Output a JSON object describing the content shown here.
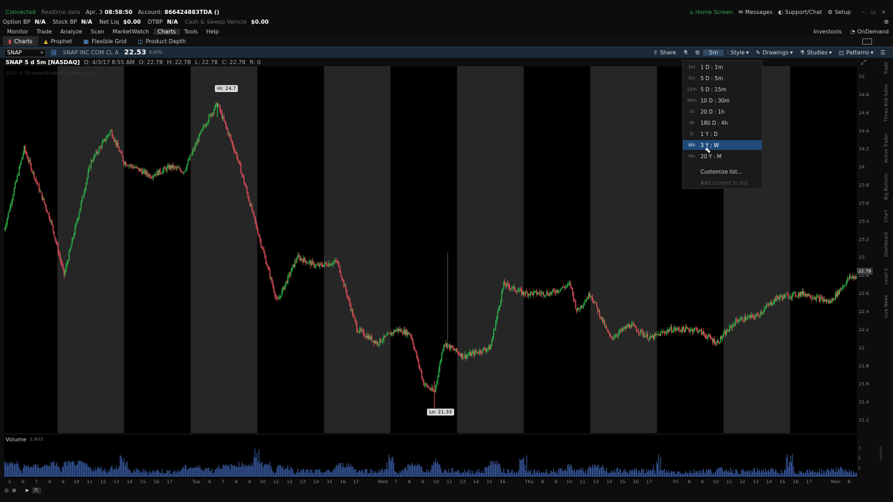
{
  "status_bar": {
    "connection": "Connected",
    "data_mode": "Realtime data",
    "date": "Apr, 3",
    "time": "08:58:50",
    "account_label": "Account:",
    "account_id": "866424883TDA ()",
    "home_screen": "Home Screen",
    "messages": "Messages",
    "support": "Support/Chat",
    "setup": "Setup"
  },
  "account_bar": {
    "option_bp_label": "Option BP",
    "option_bp_value": "N/A",
    "stock_bp_label": "Stock BP",
    "stock_bp_value": "N/A",
    "net_liq_label": "Net Liq",
    "net_liq_value": "$0.00",
    "dtbp_label": "DTBP",
    "dtbp_value": "N/A",
    "cash_sweep_label": "Cash & Sweep Vehicle",
    "cash_sweep_value": "$0.00"
  },
  "menu": {
    "items": [
      "Monitor",
      "Trade",
      "Analyze",
      "Scan",
      "MarketWatch",
      "Charts",
      "Tools",
      "Help"
    ],
    "active": "Charts",
    "investools": "Investools",
    "ondemand": "OnDemand"
  },
  "tabs": {
    "charts": "Charts",
    "prophet": "Prophet",
    "flexible_grid": "Flexible Grid",
    "product_depth": "Product Depth"
  },
  "chart_toolbar": {
    "symbol": "SNAP",
    "company": "SNAP INC COM CL A",
    "price": "22.53",
    "change": "0.00%",
    "share": "Share",
    "timeframe": "5m",
    "style": "Style",
    "drawings": "Drawings",
    "studies": "Studies",
    "patterns": "Patterns"
  },
  "chart_header": {
    "title": "SNAP 5 d 5m [NASDAQ]",
    "info": "D: 4/3/17 8:55 AM",
    "open": "O: 22.78",
    "high": "H: 22.78",
    "low": "L: 22.78",
    "close": "C: 22.78",
    "r": "R: 0",
    "copyright": "2017 © TD Ameritrade IP Company, Inc."
  },
  "dropdown": {
    "items": [
      {
        "key": "1m",
        "label": "1 D : 1m"
      },
      {
        "key": "5m",
        "label": "5 D : 5m"
      },
      {
        "key": "15m",
        "label": "5 D : 15m"
      },
      {
        "key": "30m",
        "label": "10 D : 30m"
      },
      {
        "key": "1h",
        "label": "20 D : 1h"
      },
      {
        "key": "4h",
        "label": "180 D : 4h"
      },
      {
        "key": "D",
        "label": "1 Y : D"
      },
      {
        "key": "Wk",
        "label": "3 Y : W"
      },
      {
        "key": "Mo",
        "label": "20 Y : M"
      }
    ],
    "selected": "3 Y : W",
    "customize": "Customize list...",
    "add_current": "Add current to list"
  },
  "chart": {
    "hi_label": "Hi: 24.7",
    "lo_label": "Lo: 21.33",
    "current_price_tag": "22.78"
  },
  "volume": {
    "label": "Volume",
    "value": "2,803",
    "axis": [
      "3",
      "2",
      "1"
    ],
    "axis_unit": "millions"
  },
  "side_tabs": [
    "Trade",
    "Times And Sales",
    "Active Trader",
    "Big Buttons",
    "Chart",
    "Dashboard",
    "Level II",
    "Live News"
  ],
  "chart_data": {
    "type": "candlestick",
    "y_ticks": [
      "25",
      "24.8",
      "24.6",
      "24.4",
      "24.2",
      "24",
      "23.8",
      "23.6",
      "23.4",
      "23.2",
      "23",
      "22.8",
      "22.6",
      "22.4",
      "22.2",
      "22",
      "21.8",
      "21.6",
      "21.4",
      "21.2"
    ],
    "ylim": [
      21.1,
      25.05
    ],
    "x_ticks": [
      {
        "t": 0,
        "label": "5"
      },
      {
        "t": 1,
        "label": "6"
      },
      {
        "t": 2,
        "label": "7"
      },
      {
        "t": 3,
        "label": "8"
      },
      {
        "t": 4,
        "label": "9"
      },
      {
        "t": 5,
        "label": "10"
      },
      {
        "t": 6,
        "label": "11"
      },
      {
        "t": 7,
        "label": "12"
      },
      {
        "t": 8,
        "label": "13"
      },
      {
        "t": 9,
        "label": "14"
      },
      {
        "t": 10,
        "label": "15"
      },
      {
        "t": 11,
        "label": "16"
      },
      {
        "t": 12,
        "label": "17"
      },
      {
        "t": 14,
        "label": "Tue"
      },
      {
        "t": 15,
        "label": "6"
      },
      {
        "t": 16,
        "label": "7"
      },
      {
        "t": 17,
        "label": "8"
      },
      {
        "t": 18,
        "label": "9"
      },
      {
        "t": 19,
        "label": "10"
      },
      {
        "t": 20,
        "label": "11"
      },
      {
        "t": 21,
        "label": "12"
      },
      {
        "t": 22,
        "label": "13"
      },
      {
        "t": 23,
        "label": "14"
      },
      {
        "t": 24,
        "label": "15"
      },
      {
        "t": 25,
        "label": "16"
      },
      {
        "t": 26,
        "label": "17"
      },
      {
        "t": 28,
        "label": "Wed"
      },
      {
        "t": 29,
        "label": "7"
      },
      {
        "t": 30,
        "label": "8"
      },
      {
        "t": 31,
        "label": "9"
      },
      {
        "t": 32,
        "label": "10"
      },
      {
        "t": 33,
        "label": "11"
      },
      {
        "t": 34,
        "label": "13"
      },
      {
        "t": 35,
        "label": "14"
      },
      {
        "t": 36,
        "label": "15"
      },
      {
        "t": 37,
        "label": "16"
      },
      {
        "t": 39,
        "label": "Thu"
      },
      {
        "t": 40,
        "label": "8"
      },
      {
        "t": 41,
        "label": "9"
      },
      {
        "t": 42,
        "label": "10"
      },
      {
        "t": 43,
        "label": "11"
      },
      {
        "t": 44,
        "label": "13"
      },
      {
        "t": 45,
        "label": "14"
      },
      {
        "t": 46,
        "label": "15"
      },
      {
        "t": 47,
        "label": "16"
      },
      {
        "t": 48,
        "label": "17"
      },
      {
        "t": 50,
        "label": "Fri"
      },
      {
        "t": 51,
        "label": "8"
      },
      {
        "t": 52,
        "label": "9"
      },
      {
        "t": 53,
        "label": "10"
      },
      {
        "t": 54,
        "label": "11"
      },
      {
        "t": 55,
        "label": "12"
      },
      {
        "t": 56,
        "label": "13"
      },
      {
        "t": 57,
        "label": "14"
      },
      {
        "t": 58,
        "label": "15"
      },
      {
        "t": 59,
        "label": "16"
      },
      {
        "t": 60,
        "label": "17"
      },
      {
        "t": 62,
        "label": "Mon"
      },
      {
        "t": 63,
        "label": "8"
      }
    ],
    "x_range": [
      0,
      64
    ],
    "session_bands": [
      [
        4,
        9
      ],
      [
        14,
        19
      ],
      [
        24,
        29
      ],
      [
        34,
        39
      ],
      [
        44,
        49
      ],
      [
        54,
        59
      ]
    ],
    "price_path": [
      {
        "t": 0,
        "p": 23.3
      },
      {
        "t": 1.5,
        "p": 24.2
      },
      {
        "t": 3.5,
        "p": 23.4
      },
      {
        "t": 4.5,
        "p": 22.8
      },
      {
        "t": 6.5,
        "p": 24.05
      },
      {
        "t": 8,
        "p": 24.4
      },
      {
        "t": 9,
        "p": 24.05
      },
      {
        "t": 11,
        "p": 23.9
      },
      {
        "t": 12.5,
        "p": 24.0
      },
      {
        "t": 13.5,
        "p": 23.95
      },
      {
        "t": 15,
        "p": 24.45
      },
      {
        "t": 16,
        "p": 24.7
      },
      {
        "t": 17.5,
        "p": 24.1
      },
      {
        "t": 19,
        "p": 23.3
      },
      {
        "t": 20.5,
        "p": 22.5
      },
      {
        "t": 22,
        "p": 23.0
      },
      {
        "t": 23.5,
        "p": 22.9
      },
      {
        "t": 25,
        "p": 22.95
      },
      {
        "t": 26.5,
        "p": 22.2
      },
      {
        "t": 28,
        "p": 22.05
      },
      {
        "t": 29.5,
        "p": 22.2
      },
      {
        "t": 30.5,
        "p": 22.15
      },
      {
        "t": 31.5,
        "p": 21.6
      },
      {
        "t": 32.3,
        "p": 21.5
      },
      {
        "t": 33,
        "p": 22.05
      },
      {
        "t": 34.5,
        "p": 21.9
      },
      {
        "t": 36.5,
        "p": 22.0
      },
      {
        "t": 37.5,
        "p": 22.7
      },
      {
        "t": 39,
        "p": 22.6
      },
      {
        "t": 41,
        "p": 22.6
      },
      {
        "t": 42.5,
        "p": 22.7
      },
      {
        "t": 43,
        "p": 22.4
      },
      {
        "t": 44,
        "p": 22.6
      },
      {
        "t": 45.5,
        "p": 22.1
      },
      {
        "t": 47,
        "p": 22.25
      },
      {
        "t": 48.5,
        "p": 22.1
      },
      {
        "t": 50,
        "p": 22.2
      },
      {
        "t": 52,
        "p": 22.2
      },
      {
        "t": 53.5,
        "p": 22.05
      },
      {
        "t": 55,
        "p": 22.3
      },
      {
        "t": 56.5,
        "p": 22.35
      },
      {
        "t": 58,
        "p": 22.55
      },
      {
        "t": 60,
        "p": 22.6
      },
      {
        "t": 62,
        "p": 22.5
      },
      {
        "t": 63.5,
        "p": 22.78
      }
    ],
    "hi": {
      "t": 16,
      "p": 24.7
    },
    "lo": {
      "t": 32.3,
      "p": 21.33
    }
  },
  "colors": {
    "up": "#2fb84a",
    "down": "#e2505a",
    "band": "#262626",
    "accent": "#1f4a7a",
    "connected": "#2fa84f"
  }
}
